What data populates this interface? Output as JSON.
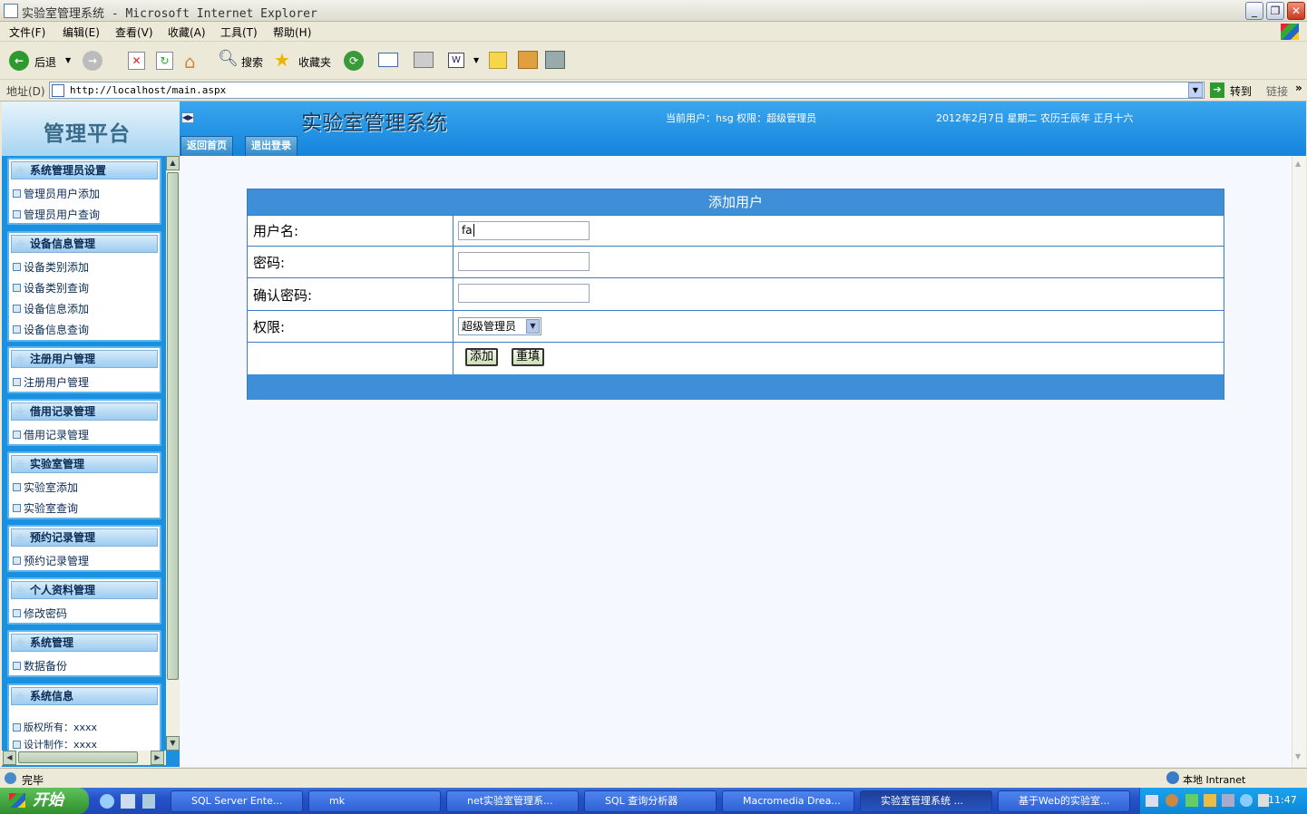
{
  "window": {
    "title": "实验室管理系统 - Microsoft Internet Explorer"
  },
  "menu": [
    "文件(F)",
    "编辑(E)",
    "查看(V)",
    "收藏(A)",
    "工具(T)",
    "帮助(H)"
  ],
  "toolbar": {
    "back": "后退",
    "search": "搜索",
    "favorites": "收藏夹"
  },
  "address": {
    "label": "地址(D)",
    "url": "http://localhost/main.aspx",
    "go": "转到",
    "links": "链接"
  },
  "header": {
    "logo": "管理平台",
    "system_name": "实验室管理系统",
    "user_info": "当前用户：hsg 权限：超级管理员",
    "date": "2012年2月7日 星期二 农历壬辰年 正月十六",
    "nav": [
      "返回首页",
      "退出登录"
    ]
  },
  "sidebar": {
    "groups": [
      {
        "title": "系统管理员设置",
        "items": [
          "管理员用户添加",
          "管理员用户查询"
        ]
      },
      {
        "title": "设备信息管理",
        "items": [
          "设备类别添加",
          "设备类别查询",
          "设备信息添加",
          "设备信息查询"
        ]
      },
      {
        "title": "注册用户管理",
        "items": [
          "注册用户管理"
        ]
      },
      {
        "title": "借用记录管理",
        "items": [
          "借用记录管理"
        ]
      },
      {
        "title": "实验室管理",
        "items": [
          "实验室添加",
          "实验室查询"
        ]
      },
      {
        "title": "预约记录管理",
        "items": [
          "预约记录管理"
        ]
      },
      {
        "title": "个人资料管理",
        "items": [
          "修改密码"
        ]
      },
      {
        "title": "系统管理",
        "items": [
          "数据备份"
        ]
      },
      {
        "title": "系统信息",
        "items": [
          "版权所有：xxxx",
          "设计制作：xxxx"
        ]
      }
    ]
  },
  "form": {
    "title": "添加用户",
    "username_label": "用户名:",
    "username_value": "fa",
    "password_label": "密码:",
    "confirm_label": "确认密码:",
    "role_label": "权限:",
    "role_value": "超级管理员",
    "add_button": "添加",
    "reset_button": "重填"
  },
  "status": {
    "text": "完毕",
    "zone": "本地 Intranet"
  },
  "taskbar": {
    "start": "开始",
    "tasks": [
      "SQL Server Ente...",
      "mk",
      "net实验室管理系...",
      "SQL 查询分析器",
      "Macromedia Drea...",
      "实验室管理系统 ...",
      "基于Web的实验室..."
    ],
    "clock": "11:47"
  },
  "colors": {
    "header_blue": "#1484dc",
    "form_blue": "#3f8fd8",
    "sidebar_blue": "#1990e0"
  }
}
